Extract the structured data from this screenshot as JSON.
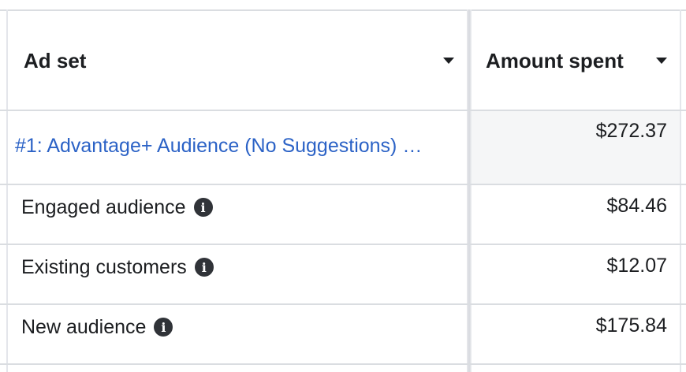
{
  "header": {
    "ad_set_label": "Ad set",
    "amount_spent_label": "Amount spent"
  },
  "rows": [
    {
      "name": "#1: Advantage+ Audience (No Suggestions) …",
      "amount": "$272.37",
      "is_link": true
    },
    {
      "name": "Engaged audience",
      "amount": "$84.46",
      "info_icon": "info-icon"
    },
    {
      "name": "Existing customers",
      "amount": "$12.07",
      "info_icon": "info-icon"
    },
    {
      "name": "New audience",
      "amount": "$175.84",
      "info_icon": "info-icon"
    }
  ],
  "colors": {
    "link": "#2b62c6",
    "text": "#1c1e21",
    "grid": "#dadde1",
    "highlight_row": "#f5f6f7"
  }
}
